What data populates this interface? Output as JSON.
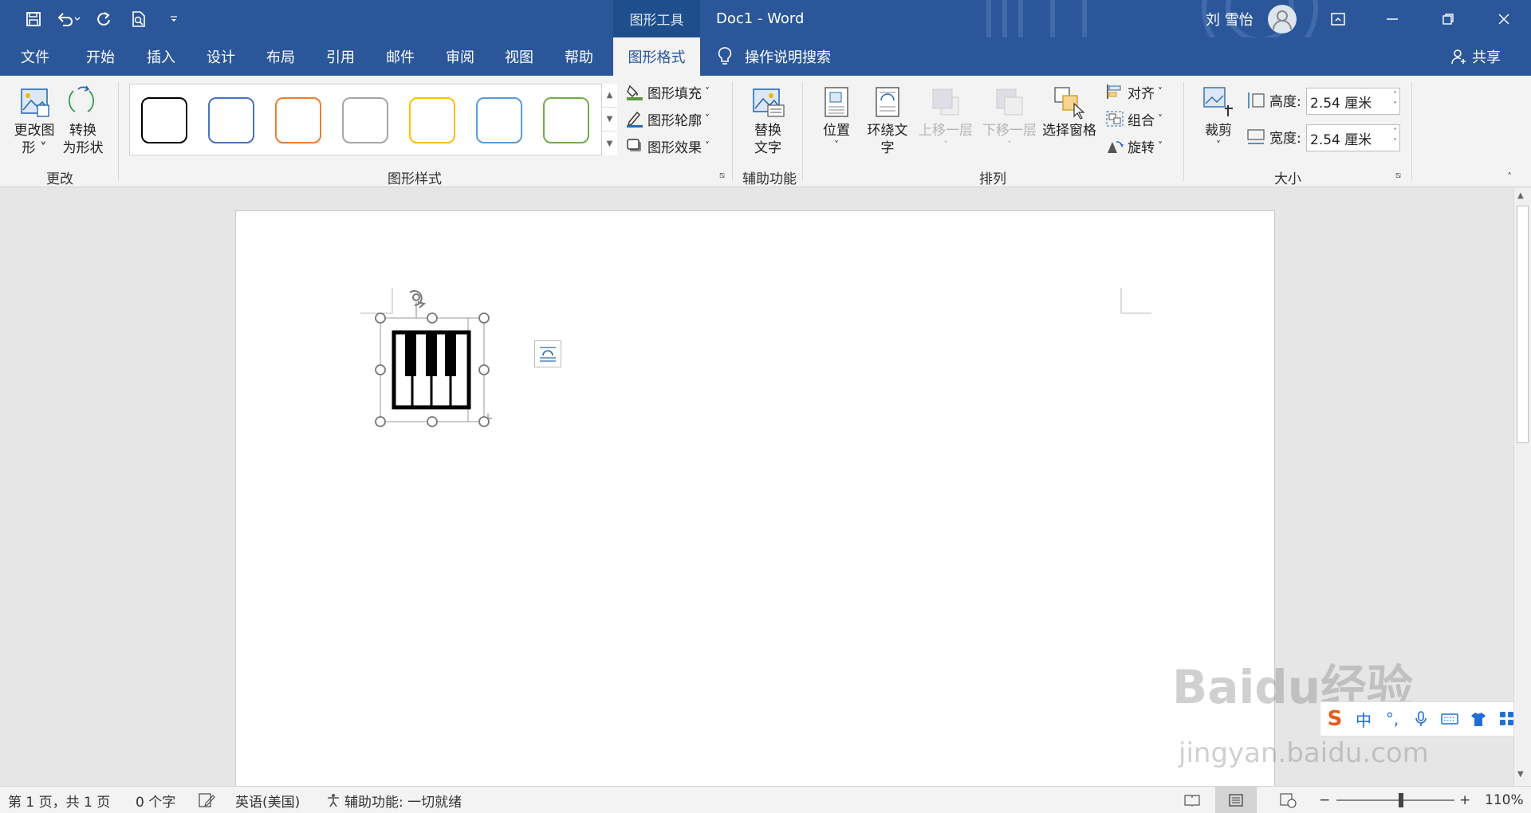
{
  "titlebar": {
    "context_tool": "图形工具",
    "doc_title": "Doc1  -  Word",
    "user_name": "刘 雪怡",
    "qa_icons": [
      "save-icon",
      "undo-icon",
      "redo-icon",
      "print-preview-icon",
      "customize-qa-icon"
    ]
  },
  "tabs": {
    "items": [
      "文件",
      "开始",
      "插入",
      "设计",
      "布局",
      "引用",
      "邮件",
      "审阅",
      "视图",
      "帮助",
      "图形格式"
    ],
    "active": "图形格式",
    "search": "操作说明搜索",
    "share": "共享"
  },
  "ribbon": {
    "change_group": {
      "label": "更改",
      "change_shape": "更改图\n形 ˅",
      "convert": "转换\n为形状"
    },
    "styles_group": {
      "label": "图形样式",
      "swatch_colors": [
        "#000000",
        "#4472c4",
        "#ed7d31",
        "#a5a5a5",
        "#ffc000",
        "#5b9bd5",
        "#70ad47"
      ],
      "fill": "图形填充",
      "outline": "图形轮廓",
      "effects": "图形效果"
    },
    "a11y_group": {
      "label": "辅助功能",
      "alt_text": "替换\n文字"
    },
    "arrange_group": {
      "label": "排列",
      "position": "位置",
      "wrap_text": "环绕文\n字",
      "bring_forward": "上移一层",
      "send_backward": "下移一层",
      "selection_pane": "选择窗格",
      "align": "对齐",
      "group": "组合",
      "rotate": "旋转"
    },
    "size_group": {
      "label": "大小",
      "crop": "裁剪",
      "height_label": "高度:",
      "height_value": "2.54 厘米",
      "width_label": "宽度:",
      "width_value": "2.54 厘米"
    }
  },
  "status": {
    "page": "第 1 页，共 1 页",
    "words": "0 个字",
    "language": "英语(美国)",
    "accessibility": "辅助功能: 一切就绪",
    "zoom": "110%",
    "zoom_level": 0.55
  },
  "ime": {
    "mode": "中"
  },
  "watermark": {
    "main": "Baidu经验",
    "sub": "jingyan.baidu.com"
  },
  "colors": {
    "brand": "#2b579a",
    "ribbon_bg": "#f3f3f3"
  }
}
